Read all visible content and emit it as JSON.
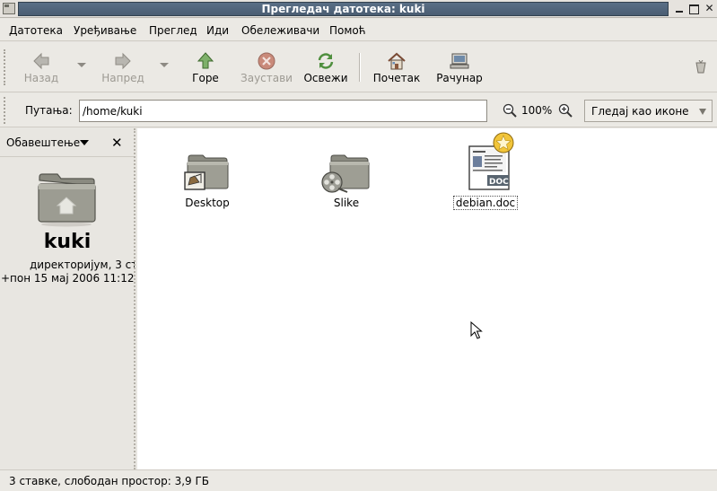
{
  "window": {
    "title": "Прегледач датотека: kuki"
  },
  "menu": {
    "items": [
      "Датотека",
      "Уређивање",
      "Преглед",
      "Иди",
      "Обележивачи",
      "Помоћ"
    ]
  },
  "toolbar": {
    "back_label": "Назад",
    "forward_label": "Напред",
    "up_label": "Горе",
    "stop_label": "Заустави",
    "reload_label": "Освежи",
    "home_label": "Почетак",
    "computer_label": "Рачунар"
  },
  "location": {
    "label": "Путања:",
    "value": "/home/kuki",
    "zoom": "100%",
    "view_mode": "Гледај као иконе"
  },
  "sidepane": {
    "selector": "Обавештење",
    "folder_name": "kuki",
    "info_line1": "директоријум, 3 ст",
    "info_line2": "+пон 15 мај 2006 11:12"
  },
  "files": [
    {
      "name": "Desktop",
      "icon": "desktop-folder-icon"
    },
    {
      "name": "Slike",
      "icon": "pictures-folder-icon"
    },
    {
      "name": "debian.doc",
      "icon": "document-icon"
    }
  ],
  "status": {
    "text": "3 ставке, слободан простор: 3,9 ГБ"
  },
  "colors": {
    "title_bar": "#4f6378",
    "content_bg": "#ffffff",
    "chrome_bg": "#ebe9e4"
  }
}
